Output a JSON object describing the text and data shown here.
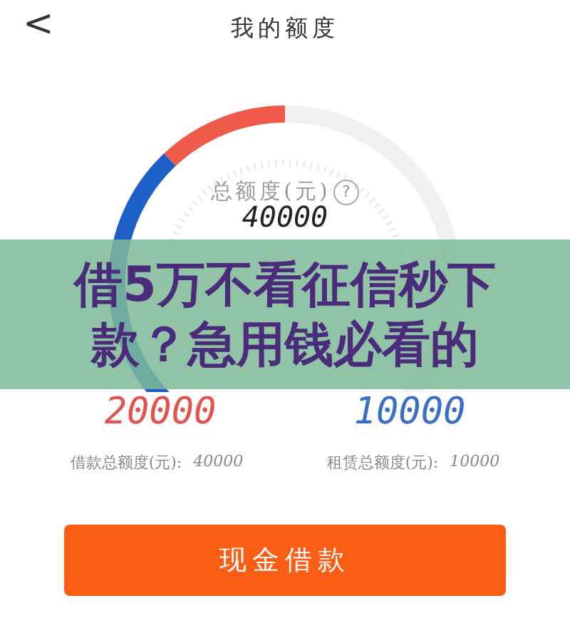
{
  "header": {
    "back": "<",
    "title": "我的额度"
  },
  "gauge": {
    "label": "总额度(元)",
    "help": "?",
    "total": "40000"
  },
  "amounts": [
    {
      "value": "20000",
      "color": "#e0534e",
      "label": "借款总额度(元):",
      "total": "40000"
    },
    {
      "value": "10000",
      "color": "#3a6fc6",
      "label": "租赁总额度(元):",
      "total": "10000"
    }
  ],
  "button": "现金借款",
  "banner": {
    "lines": [
      "借5万不看征信秒下",
      "款？急用钱必看的"
    ]
  }
}
